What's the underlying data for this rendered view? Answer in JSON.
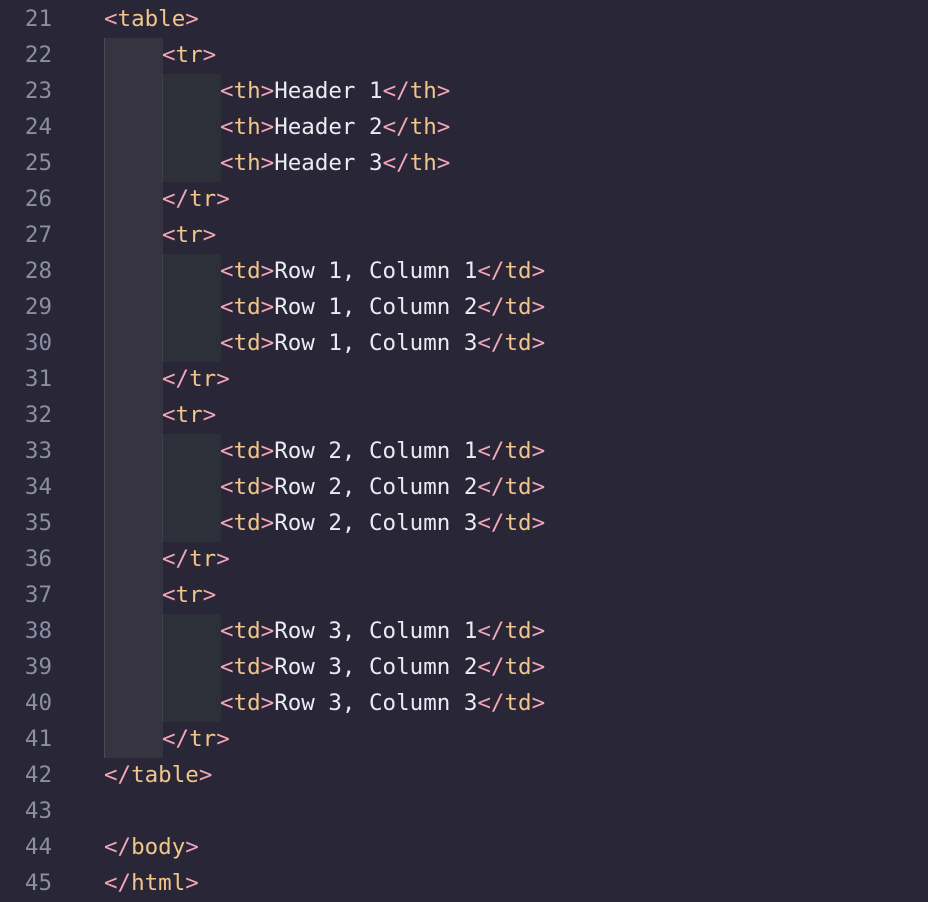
{
  "editor": {
    "language": "html",
    "colors": {
      "background": "#282637",
      "line_number": "#8b8fa3",
      "punctuation": "#f4a6b8",
      "tag_name": "#f2c58a",
      "text": "#eceaf2"
    },
    "lines": [
      {
        "num": "21",
        "indent": 1,
        "tokens": [
          [
            "p",
            "<"
          ],
          [
            "t",
            "table"
          ],
          [
            "p",
            ">"
          ]
        ]
      },
      {
        "num": "22",
        "indent": 2,
        "tokens": [
          [
            "p",
            "<"
          ],
          [
            "t",
            "tr"
          ],
          [
            "p",
            ">"
          ]
        ]
      },
      {
        "num": "23",
        "indent": 3,
        "tokens": [
          [
            "p",
            "<"
          ],
          [
            "t",
            "th"
          ],
          [
            "p",
            ">"
          ],
          [
            "x",
            "Header 1"
          ],
          [
            "p",
            "</"
          ],
          [
            "t",
            "th"
          ],
          [
            "p",
            ">"
          ]
        ]
      },
      {
        "num": "24",
        "indent": 3,
        "tokens": [
          [
            "p",
            "<"
          ],
          [
            "t",
            "th"
          ],
          [
            "p",
            ">"
          ],
          [
            "x",
            "Header 2"
          ],
          [
            "p",
            "</"
          ],
          [
            "t",
            "th"
          ],
          [
            "p",
            ">"
          ]
        ]
      },
      {
        "num": "25",
        "indent": 3,
        "tokens": [
          [
            "p",
            "<"
          ],
          [
            "t",
            "th"
          ],
          [
            "p",
            ">"
          ],
          [
            "x",
            "Header 3"
          ],
          [
            "p",
            "</"
          ],
          [
            "t",
            "th"
          ],
          [
            "p",
            ">"
          ]
        ]
      },
      {
        "num": "26",
        "indent": 2,
        "tokens": [
          [
            "p",
            "</"
          ],
          [
            "t",
            "tr"
          ],
          [
            "p",
            ">"
          ]
        ]
      },
      {
        "num": "27",
        "indent": 2,
        "tokens": [
          [
            "p",
            "<"
          ],
          [
            "t",
            "tr"
          ],
          [
            "p",
            ">"
          ]
        ]
      },
      {
        "num": "28",
        "indent": 3,
        "tokens": [
          [
            "p",
            "<"
          ],
          [
            "t",
            "td"
          ],
          [
            "p",
            ">"
          ],
          [
            "x",
            "Row 1, Column 1"
          ],
          [
            "p",
            "</"
          ],
          [
            "t",
            "td"
          ],
          [
            "p",
            ">"
          ]
        ]
      },
      {
        "num": "29",
        "indent": 3,
        "tokens": [
          [
            "p",
            "<"
          ],
          [
            "t",
            "td"
          ],
          [
            "p",
            ">"
          ],
          [
            "x",
            "Row 1, Column 2"
          ],
          [
            "p",
            "</"
          ],
          [
            "t",
            "td"
          ],
          [
            "p",
            ">"
          ]
        ]
      },
      {
        "num": "30",
        "indent": 3,
        "tokens": [
          [
            "p",
            "<"
          ],
          [
            "t",
            "td"
          ],
          [
            "p",
            ">"
          ],
          [
            "x",
            "Row 1, Column 3"
          ],
          [
            "p",
            "</"
          ],
          [
            "t",
            "td"
          ],
          [
            "p",
            ">"
          ]
        ]
      },
      {
        "num": "31",
        "indent": 2,
        "tokens": [
          [
            "p",
            "</"
          ],
          [
            "t",
            "tr"
          ],
          [
            "p",
            ">"
          ]
        ]
      },
      {
        "num": "32",
        "indent": 2,
        "tokens": [
          [
            "p",
            "<"
          ],
          [
            "t",
            "tr"
          ],
          [
            "p",
            ">"
          ]
        ]
      },
      {
        "num": "33",
        "indent": 3,
        "tokens": [
          [
            "p",
            "<"
          ],
          [
            "t",
            "td"
          ],
          [
            "p",
            ">"
          ],
          [
            "x",
            "Row 2, Column 1"
          ],
          [
            "p",
            "</"
          ],
          [
            "t",
            "td"
          ],
          [
            "p",
            ">"
          ]
        ]
      },
      {
        "num": "34",
        "indent": 3,
        "tokens": [
          [
            "p",
            "<"
          ],
          [
            "t",
            "td"
          ],
          [
            "p",
            ">"
          ],
          [
            "x",
            "Row 2, Column 2"
          ],
          [
            "p",
            "</"
          ],
          [
            "t",
            "td"
          ],
          [
            "p",
            ">"
          ]
        ]
      },
      {
        "num": "35",
        "indent": 3,
        "tokens": [
          [
            "p",
            "<"
          ],
          [
            "t",
            "td"
          ],
          [
            "p",
            ">"
          ],
          [
            "x",
            "Row 2, Column 3"
          ],
          [
            "p",
            "</"
          ],
          [
            "t",
            "td"
          ],
          [
            "p",
            ">"
          ]
        ]
      },
      {
        "num": "36",
        "indent": 2,
        "tokens": [
          [
            "p",
            "</"
          ],
          [
            "t",
            "tr"
          ],
          [
            "p",
            ">"
          ]
        ]
      },
      {
        "num": "37",
        "indent": 2,
        "tokens": [
          [
            "p",
            "<"
          ],
          [
            "t",
            "tr"
          ],
          [
            "p",
            ">"
          ]
        ]
      },
      {
        "num": "38",
        "indent": 3,
        "tokens": [
          [
            "p",
            "<"
          ],
          [
            "t",
            "td"
          ],
          [
            "p",
            ">"
          ],
          [
            "x",
            "Row 3, Column 1"
          ],
          [
            "p",
            "</"
          ],
          [
            "t",
            "td"
          ],
          [
            "p",
            ">"
          ]
        ]
      },
      {
        "num": "39",
        "indent": 3,
        "tokens": [
          [
            "p",
            "<"
          ],
          [
            "t",
            "td"
          ],
          [
            "p",
            ">"
          ],
          [
            "x",
            "Row 3, Column 2"
          ],
          [
            "p",
            "</"
          ],
          [
            "t",
            "td"
          ],
          [
            "p",
            ">"
          ]
        ]
      },
      {
        "num": "40",
        "indent": 3,
        "tokens": [
          [
            "p",
            "<"
          ],
          [
            "t",
            "td"
          ],
          [
            "p",
            ">"
          ],
          [
            "x",
            "Row 3, Column 3"
          ],
          [
            "p",
            "</"
          ],
          [
            "t",
            "td"
          ],
          [
            "p",
            ">"
          ]
        ]
      },
      {
        "num": "41",
        "indent": 2,
        "tokens": [
          [
            "p",
            "</"
          ],
          [
            "t",
            "tr"
          ],
          [
            "p",
            ">"
          ]
        ]
      },
      {
        "num": "42",
        "indent": 1,
        "tokens": [
          [
            "p",
            "</"
          ],
          [
            "t",
            "table"
          ],
          [
            "p",
            ">"
          ]
        ]
      },
      {
        "num": "43",
        "indent": 1,
        "tokens": []
      },
      {
        "num": "44",
        "indent": 1,
        "tokens": [
          [
            "p",
            "</"
          ],
          [
            "t",
            "body"
          ],
          [
            "p",
            ">"
          ]
        ]
      },
      {
        "num": "45",
        "indent": 1,
        "tokens": [
          [
            "p",
            "</"
          ],
          [
            "t",
            "html"
          ],
          [
            "p",
            ">"
          ]
        ]
      }
    ]
  }
}
